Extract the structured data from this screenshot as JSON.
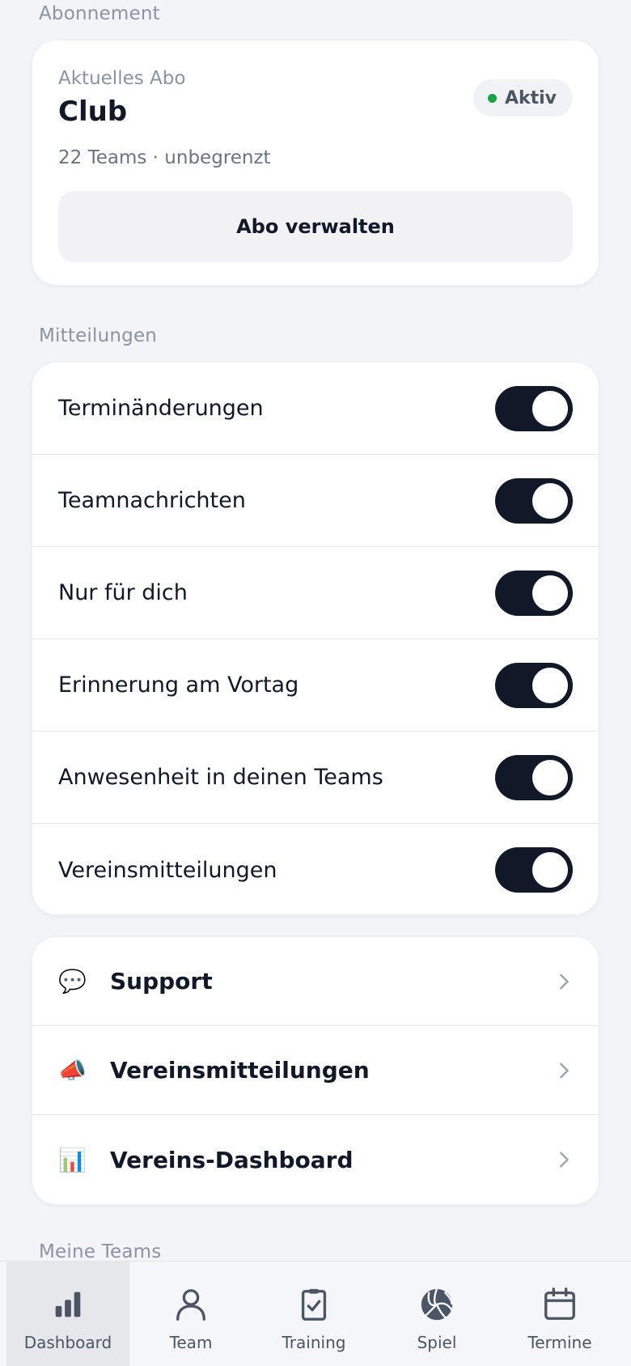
{
  "subscription": {
    "section_label": "Abonnement",
    "small_label": "Aktuelles Abo",
    "plan": "Club",
    "meta": "22 Teams · unbegrenzt",
    "status": "Aktiv",
    "status_color": "#16a34a",
    "manage_label": "Abo verwalten"
  },
  "notifications": {
    "section_label": "Mitteilungen",
    "items": [
      {
        "label": "Terminänderungen",
        "enabled": true
      },
      {
        "label": "Teamnachrichten",
        "enabled": true
      },
      {
        "label": "Nur für dich",
        "enabled": true
      },
      {
        "label": "Erinnerung am Vortag",
        "enabled": true
      },
      {
        "label": "Anwesenheit in deinen Teams",
        "enabled": true
      },
      {
        "label": "Vereinsmitteilungen",
        "enabled": true
      }
    ]
  },
  "links": [
    {
      "icon": "speech-bubble-icon",
      "emoji": "💬",
      "label": "Support"
    },
    {
      "icon": "megaphone-icon",
      "emoji": "📣",
      "label": "Vereinsmitteilungen"
    },
    {
      "icon": "bar-chart-icon",
      "emoji": "📊",
      "label": "Vereins-Dashboard"
    }
  ],
  "teams_section_label": "Meine Teams",
  "nav": {
    "items": [
      {
        "label": "Dashboard",
        "icon": "bar-chart-icon",
        "active": true
      },
      {
        "label": "Team",
        "icon": "person-icon",
        "active": false
      },
      {
        "label": "Training",
        "icon": "clipboard-check-icon",
        "active": false
      },
      {
        "label": "Spiel",
        "icon": "volleyball-icon",
        "active": false
      },
      {
        "label": "Termine",
        "icon": "calendar-icon",
        "active": false
      }
    ]
  },
  "colors": {
    "accent_dark": "#111827",
    "background": "#f3f4f8"
  }
}
